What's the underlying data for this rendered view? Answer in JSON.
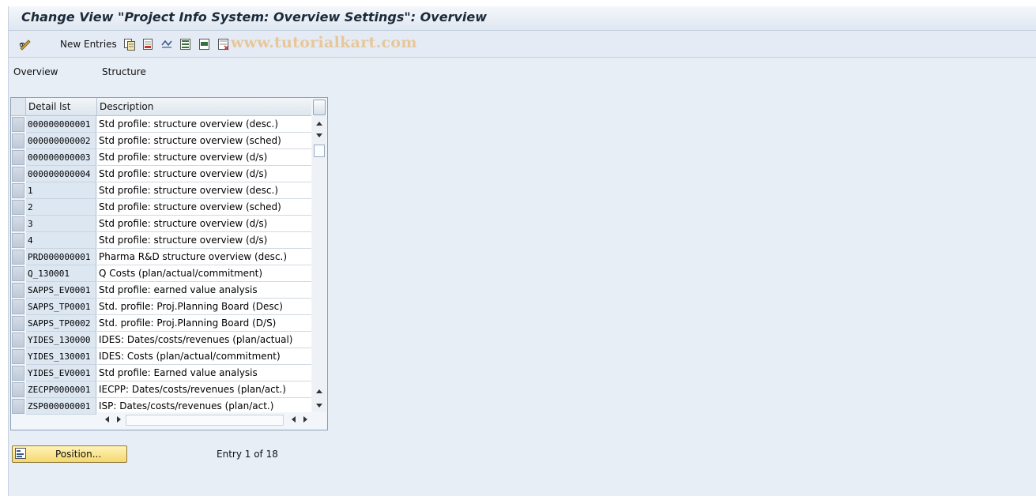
{
  "window": {
    "title": "Change View \"Project Info System: Overview Settings\": Overview"
  },
  "toolbar": {
    "new_entries_label": "New Entries",
    "icons": [
      "edit-toggle-icon",
      "copy-icon",
      "delete-icon",
      "undo-icon",
      "select-all-icon",
      "select-block-icon",
      "deselect-icon"
    ],
    "watermark": "www.tutorialkart.com"
  },
  "nav": {
    "overview": "Overview",
    "structure": "Structure"
  },
  "table": {
    "columns": [
      "Detail lst",
      "Description"
    ],
    "rows": [
      [
        "000000000001",
        "Std profile: structure overview (desc.)"
      ],
      [
        "000000000002",
        "Std profile: structure overview (sched)"
      ],
      [
        "000000000003",
        "Std profile: structure overview (d/s)"
      ],
      [
        "000000000004",
        "Std profile: structure overview (d/s)"
      ],
      [
        "1",
        "Std profile: structure overview (desc.)"
      ],
      [
        "2",
        "Std profile: structure overview (sched)"
      ],
      [
        "3",
        "Std profile: structure overview (d/s)"
      ],
      [
        "4",
        "Std profile: structure overview (d/s)"
      ],
      [
        "PRD000000001",
        "Pharma R&D structure overview (desc.)"
      ],
      [
        "Q_130001",
        "Q Costs (plan/actual/commitment)"
      ],
      [
        "SAPPS_EV0001",
        "Std profile: earned value analysis"
      ],
      [
        "SAPPS_TP0001",
        "Std. profile: Proj.Planning Board (Desc)"
      ],
      [
        "SAPPS_TP0002",
        "Std. profile: Proj.Planning Board (D/S)"
      ],
      [
        "YIDES_130000",
        "IDES: Dates/costs/revenues (plan/actual)"
      ],
      [
        "YIDES_130001",
        "IDES: Costs (plan/actual/commitment)"
      ],
      [
        "YIDES_EV0001",
        "Std profile: Earned value analysis"
      ],
      [
        "ZECPP0000001",
        "IECPP: Dates/costs/revenues (plan/act.)"
      ],
      [
        "ZSP000000001",
        "ISP: Dates/costs/revenues (plan/act.)"
      ]
    ]
  },
  "footer": {
    "position_button": "Position...",
    "entry_text": "Entry 1 of 18"
  },
  "colors": {
    "background": "#e8eef6",
    "button_yellow": "#f4d86f",
    "watermark": "#e7c79a"
  }
}
